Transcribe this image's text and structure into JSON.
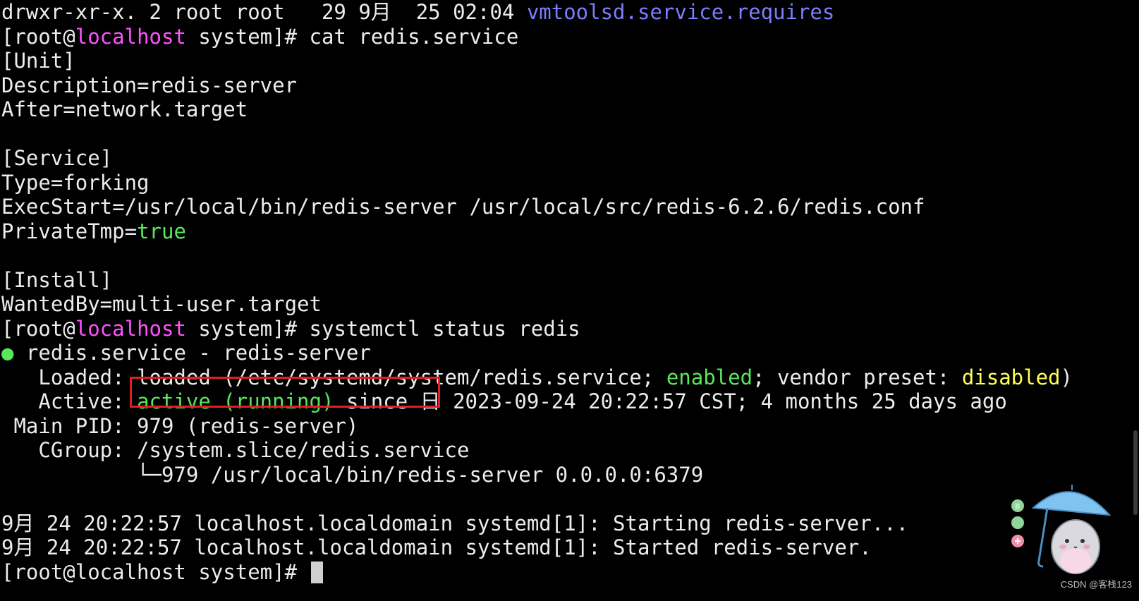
{
  "terminal": {
    "lines": [
      {
        "segments": [
          {
            "text": "drwxr-xr-x. 2 root root   29 9月  25 02:04 ",
            "color": "default"
          },
          {
            "text": "vmtoolsd.service.requires",
            "color": "blue"
          }
        ]
      },
      {
        "segments": [
          {
            "text": "[root@",
            "color": "default"
          },
          {
            "text": "localhost",
            "color": "magenta"
          },
          {
            "text": " system]# cat redis.service",
            "color": "default"
          }
        ]
      },
      {
        "segments": [
          {
            "text": "[Unit]",
            "color": "default"
          }
        ]
      },
      {
        "segments": [
          {
            "text": "Description=redis-server",
            "color": "default"
          }
        ]
      },
      {
        "segments": [
          {
            "text": "After=network.target",
            "color": "default"
          }
        ]
      },
      {
        "segments": [
          {
            "text": "",
            "color": "default"
          }
        ]
      },
      {
        "segments": [
          {
            "text": "[Service]",
            "color": "default"
          }
        ]
      },
      {
        "segments": [
          {
            "text": "Type=forking",
            "color": "default"
          }
        ]
      },
      {
        "segments": [
          {
            "text": "ExecStart=/usr/local/bin/redis-server /usr/local/src/redis-6.2.6/redis.conf",
            "color": "default"
          }
        ]
      },
      {
        "segments": [
          {
            "text": "PrivateTmp=",
            "color": "default"
          },
          {
            "text": "true",
            "color": "green"
          }
        ]
      },
      {
        "segments": [
          {
            "text": "",
            "color": "default"
          }
        ]
      },
      {
        "segments": [
          {
            "text": "[Install]",
            "color": "default"
          }
        ]
      },
      {
        "segments": [
          {
            "text": "WantedBy=multi-user.target",
            "color": "default"
          }
        ]
      },
      {
        "segments": [
          {
            "text": "[root@",
            "color": "default"
          },
          {
            "text": "localhost",
            "color": "magenta"
          },
          {
            "text": " system]# systemctl status redis",
            "color": "default"
          }
        ]
      },
      {
        "segments": [
          {
            "text": "●",
            "color": "green"
          },
          {
            "text": " redis.service - redis-server",
            "color": "default"
          }
        ]
      },
      {
        "segments": [
          {
            "text": "   Loaded: loaded (/etc/systemd/system/redis.service; ",
            "color": "default"
          },
          {
            "text": "enabled",
            "color": "green"
          },
          {
            "text": "; vendor preset: ",
            "color": "default"
          },
          {
            "text": "disabled",
            "color": "yellow"
          },
          {
            "text": ")",
            "color": "default"
          }
        ]
      },
      {
        "segments": [
          {
            "text": "   Active: ",
            "color": "default"
          },
          {
            "text": "active (running)",
            "color": "green"
          },
          {
            "text": " since 日 2023-09-24 20:22:57 CST; 4 months 25 days ago",
            "color": "default"
          }
        ]
      },
      {
        "segments": [
          {
            "text": " Main PID: 979 (redis-server)",
            "color": "default"
          }
        ]
      },
      {
        "segments": [
          {
            "text": "   CGroup: /system.slice/redis.service",
            "color": "default"
          }
        ]
      },
      {
        "segments": [
          {
            "text": "           └─979 /usr/local/bin/redis-server 0.0.0.0:6379",
            "color": "default"
          }
        ]
      },
      {
        "segments": [
          {
            "text": "",
            "color": "default"
          }
        ]
      },
      {
        "segments": [
          {
            "text": "9月 24 20:22:57 localhost.localdomain systemd[1]: Starting redis-server...",
            "color": "default"
          }
        ]
      },
      {
        "segments": [
          {
            "text": "9月 24 20:22:57 localhost.localdomain systemd[1]: Started redis-server.",
            "color": "default"
          }
        ]
      },
      {
        "segments": [
          {
            "text": "[root@localhost system]# ",
            "color": "default"
          }
        ],
        "cursor": true
      }
    ]
  },
  "watermark": "CSDN @客栈123",
  "colors": {
    "background": "#000000",
    "default": "#ececec",
    "blue": "#7d7dff",
    "magenta": "#ff52ff",
    "green": "#57e85c",
    "yellow": "#ffff57",
    "highlight": "#e02020"
  },
  "icons": {
    "mascot": "hamster-umbrella-sticker-icon"
  }
}
